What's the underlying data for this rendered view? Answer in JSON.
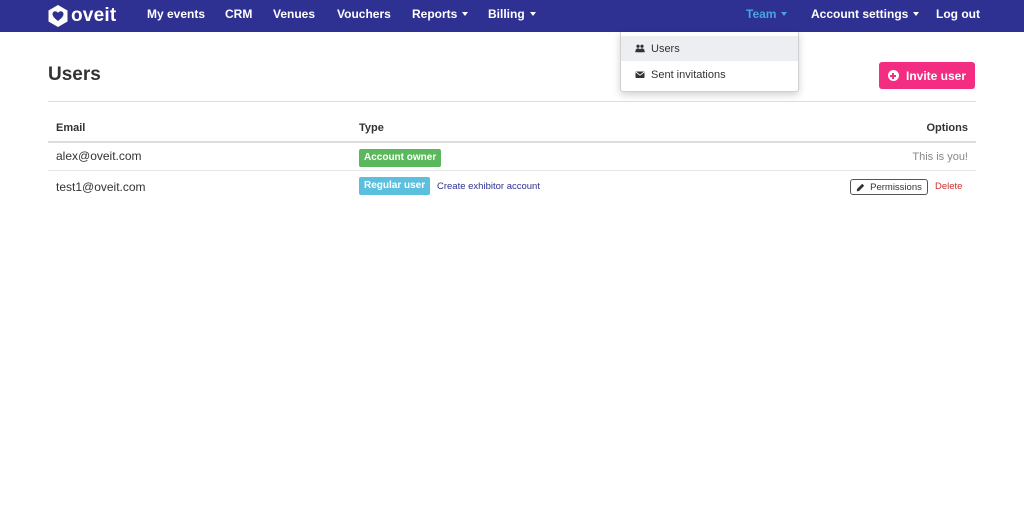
{
  "navbar": {
    "brand": "oveit",
    "items": [
      {
        "label": "My events"
      },
      {
        "label": "CRM"
      },
      {
        "label": "Venues"
      },
      {
        "label": "Vouchers"
      },
      {
        "label": "Reports"
      },
      {
        "label": "Billing"
      }
    ],
    "team": "Team",
    "account_settings": "Account settings",
    "logout": "Log out"
  },
  "team_dropdown": {
    "items": [
      {
        "label": "Users",
        "icon": "users-icon"
      },
      {
        "label": "Sent invitations",
        "icon": "envelope-icon"
      }
    ]
  },
  "page": {
    "title": "Users",
    "invite_button": "Invite user"
  },
  "table": {
    "columns": [
      "Email",
      "Type",
      "Options"
    ],
    "rows": [
      {
        "email": "alex@oveit.com",
        "type": "Account owner",
        "options": "This is you!"
      },
      {
        "email": "test1@oveit.com",
        "type": "Regular user",
        "type_link": "Create exhibitor account",
        "permissions": "Permissions",
        "delete": "Delete"
      }
    ]
  },
  "colors": {
    "navbar": "#2e3192",
    "active_nav": "#4aa3df",
    "invite_button": "#f22d82",
    "owner_badge": "#5cb85c",
    "regular_badge": "#5bc0de",
    "delete": "#c9302c"
  }
}
